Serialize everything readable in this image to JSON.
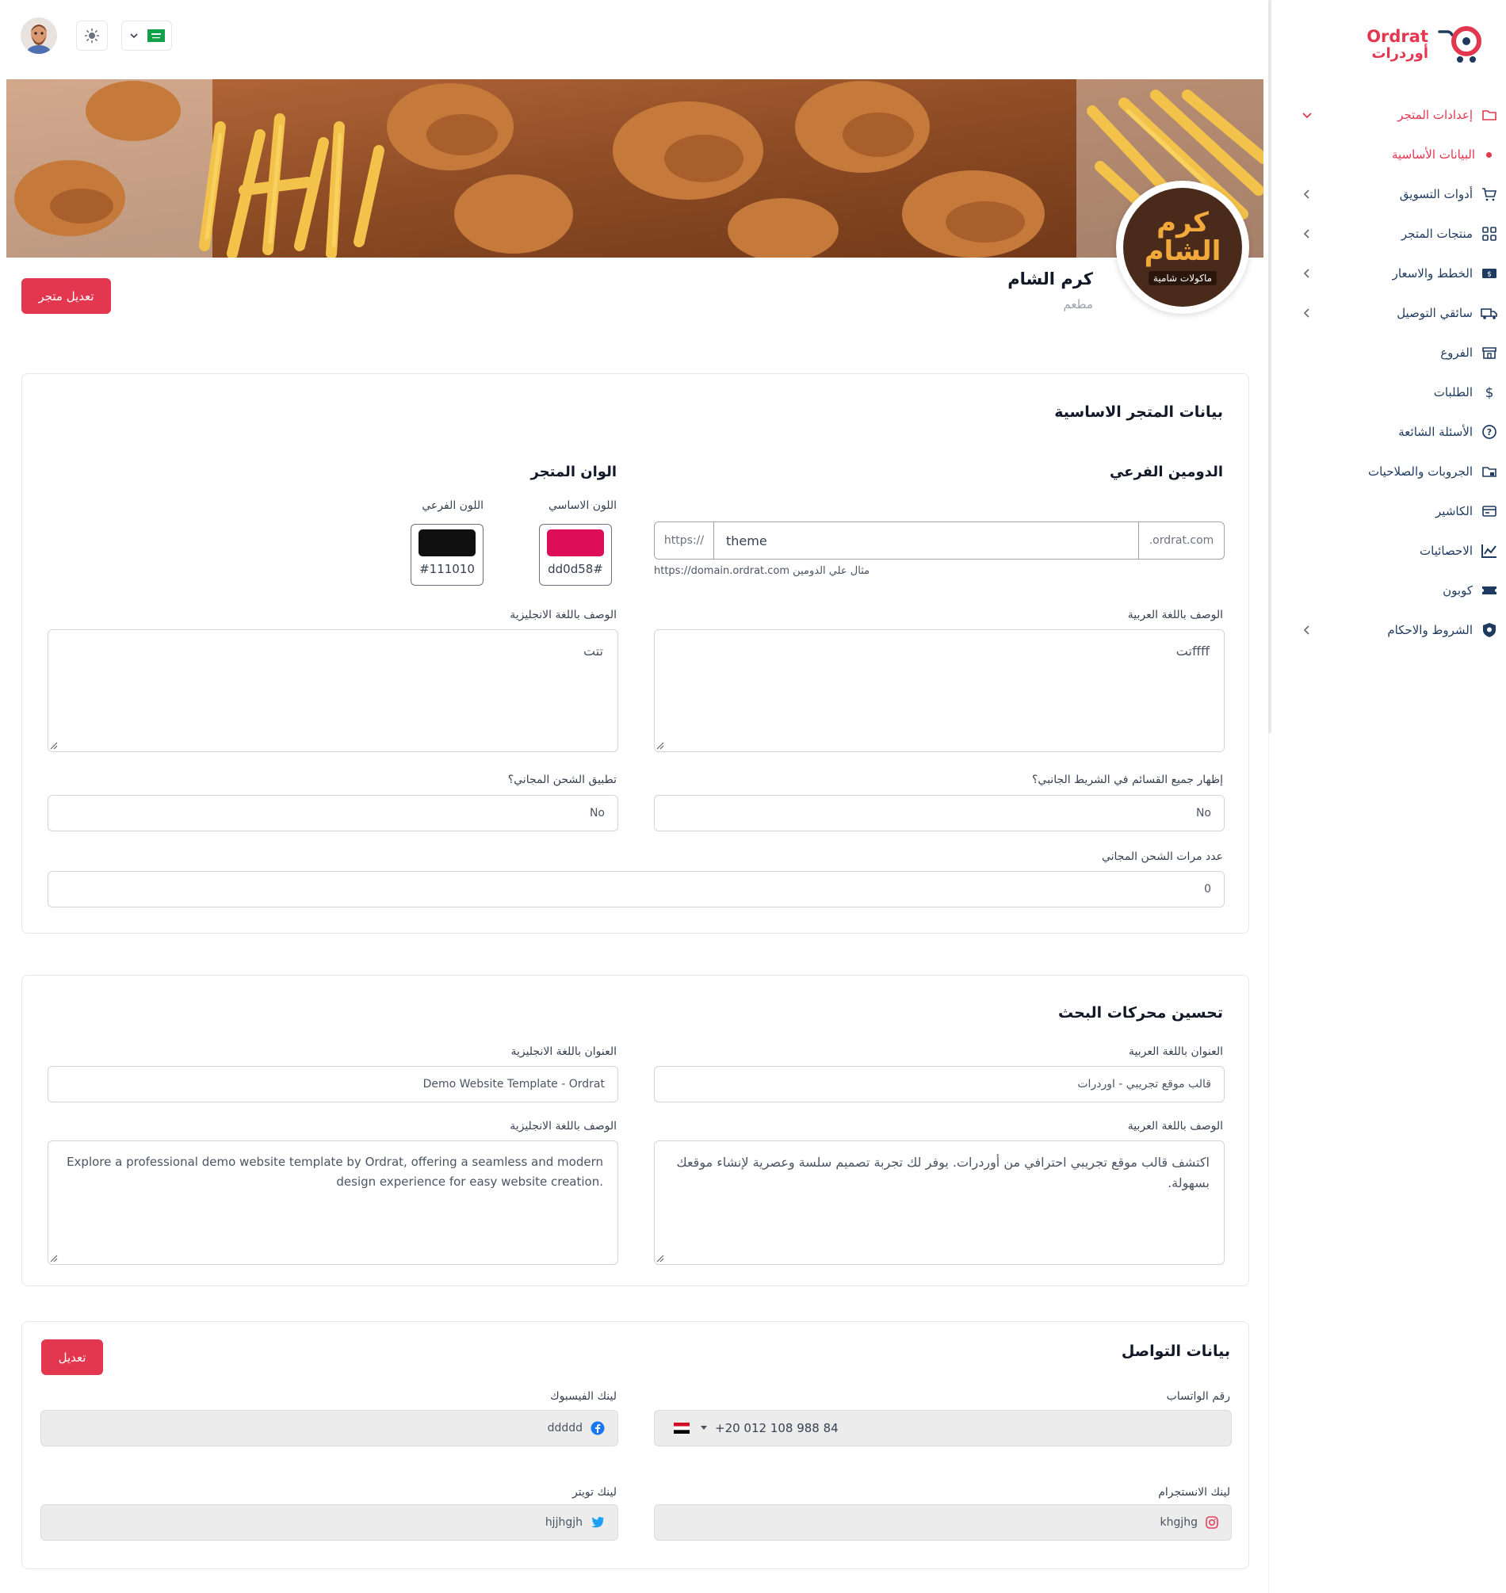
{
  "app": {
    "logo_en": "Ordrat",
    "logo_ar": "أوردرات"
  },
  "sidebar": {
    "items": [
      {
        "label": "إعدادات المتجر",
        "icon": "folder-icon",
        "expanded": true
      },
      {
        "label": "أدوات التسويق",
        "icon": "cart-icon"
      },
      {
        "label": "منتجات المتجر",
        "icon": "grid-icon"
      },
      {
        "label": "الخطط والاسعار",
        "icon": "money-icon"
      },
      {
        "label": "سائقي التوصيل",
        "icon": "truck-icon"
      },
      {
        "label": "الفروع",
        "icon": "store-icon"
      },
      {
        "label": "الطلبات",
        "icon": "dollar-icon"
      },
      {
        "label": "الأسئلة الشائعة",
        "icon": "help-icon"
      },
      {
        "label": "الجروبات والصلاحيات",
        "icon": "folder-lock-icon"
      },
      {
        "label": "الكاشير",
        "icon": "cashier-icon"
      },
      {
        "label": "الاحصائيات",
        "icon": "chart-icon"
      },
      {
        "label": "كوبون",
        "icon": "ticket-icon"
      },
      {
        "label": "الشروط والاحكام",
        "icon": "shield-icon"
      }
    ],
    "sub_active": "البيانات الأساسية"
  },
  "store": {
    "name": "كرم الشام",
    "type": "مطعم",
    "logo_text": "كرم الشام",
    "logo_tagline": "ماكولات شامية",
    "edit_label": "تعديل متجر"
  },
  "basic": {
    "title": "بيانات المتجر الاساسية",
    "subdomain_title": "الدومين الفرعي",
    "prefix": "https://",
    "subdomain_value": "theme",
    "suffix": ".ordrat.com",
    "subdomain_hint": "مثال علي الدومين https://domain.ordrat.com",
    "colors_title": "الوان المتجر",
    "primary_color_label": "اللون الاساسي",
    "primary_color_value": "dd0d58#",
    "primary_color": "#dd0d58",
    "secondary_color_label": "اللون الفرعي",
    "secondary_color_value": "#111010",
    "secondary_color": "#111010",
    "desc_ar_label": "الوصف باللغة العربية",
    "desc_ar_value": "ffffتت",
    "desc_en_label": "الوصف باللغة الانجليزية",
    "desc_en_value": "تتت",
    "show_sections_label": "إظهار جميع القسائم في الشريط الجانبي؟",
    "show_sections_value": "No",
    "free_shipping_label": "تطبيق الشحن المجاني؟",
    "free_shipping_value": "No",
    "free_shipping_count_label": "عدد مرات الشحن المجاني",
    "free_shipping_count_value": "0"
  },
  "seo": {
    "title": "تحسين محركات البحث",
    "title_ar_label": "العنوان باللغة العربية",
    "title_ar_value": "قالب موقع تجريبي - اوردرات",
    "title_en_label": "العنوان باللغة الانجليزية",
    "title_en_value": "Demo Website Template - Ordrat",
    "desc_ar_label": "الوصف باللغة العربية",
    "desc_ar_value": "اكتشف قالب موقع تجريبي احترافي من أوردرات. يوفر لك تجربة تصميم سلسة وعصرية لإنشاء موقعك بسهولة.",
    "desc_en_label": "الوصف باللغة الانجليزية",
    "desc_en_value": "Explore a professional demo website template by Ordrat, offering a seamless and modern design experience for easy website creation."
  },
  "contact": {
    "title": "بيانات التواصل",
    "edit_label": "تعديل",
    "whatsapp_label": "رقم الواتساب",
    "whatsapp_value": "+20 012 108 988 84",
    "facebook_label": "لينك الفيسبوك",
    "facebook_value": "ddddd",
    "instagram_label": "لينك الانستجرام",
    "instagram_value": "khgjhg",
    "twitter_label": "لينك تويتر",
    "twitter_value": "hjjhgjh"
  },
  "colors": {
    "accent": "#e2374f",
    "nav_text": "#1e3a5f"
  }
}
